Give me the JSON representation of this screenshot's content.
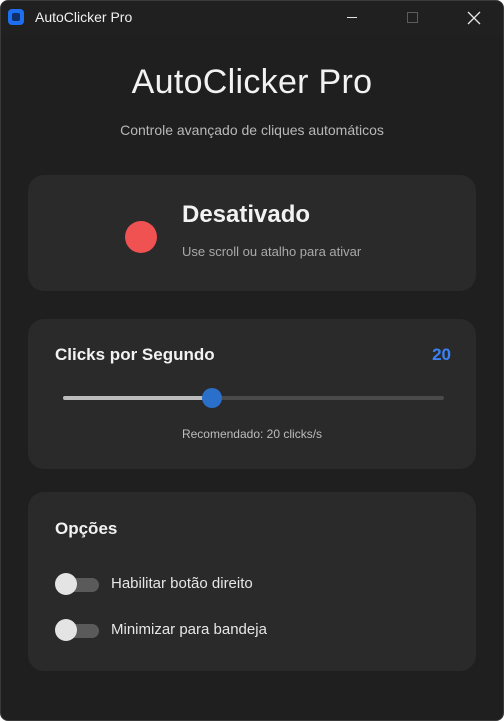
{
  "window": {
    "title": "AutoClicker Pro",
    "controls": [
      "minimize-icon",
      "maximize-icon",
      "close-icon"
    ]
  },
  "header": {
    "title": "AutoClicker Pro",
    "subtitle": "Controle avançado de cliques automáticos"
  },
  "status": {
    "label": "Desativado",
    "hint": "Use scroll ou atalho para ativar",
    "indicator_color": "#f05252"
  },
  "speed": {
    "label": "Clicks por Segundo",
    "value": "20",
    "value_color": "#3b82f6",
    "slider_level": 0.39,
    "hint": "Recomendado: 20 clicks/s"
  },
  "options": {
    "title": "Opções",
    "items": [
      {
        "label": "Habilitar botão direito",
        "enabled": false
      },
      {
        "label": "Minimizar para bandeja",
        "enabled": false
      }
    ]
  }
}
